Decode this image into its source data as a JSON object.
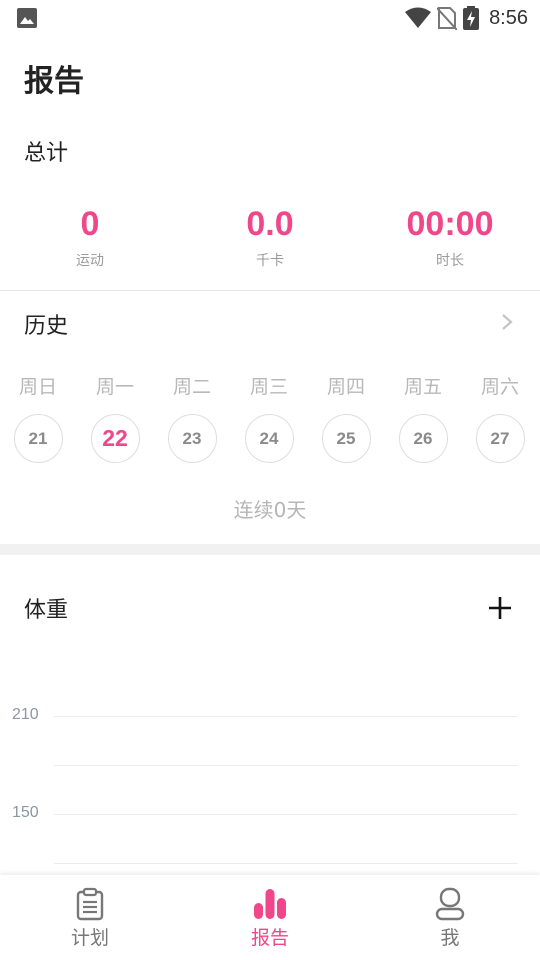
{
  "status_bar": {
    "time": "8:56",
    "icons": [
      "gallery-icon",
      "wifi-icon",
      "no-sim-icon",
      "battery-charging-icon"
    ]
  },
  "page": {
    "title": "报告"
  },
  "totals": {
    "label": "总计",
    "stats": [
      {
        "value": "0",
        "label": "运动"
      },
      {
        "value": "0.0",
        "label": "千卡"
      },
      {
        "value": "00:00",
        "label": "时长"
      }
    ]
  },
  "history": {
    "title": "历史",
    "days": [
      {
        "name": "周日",
        "date": "21"
      },
      {
        "name": "周一",
        "date": "22"
      },
      {
        "name": "周二",
        "date": "23"
      },
      {
        "name": "周三",
        "date": "24"
      },
      {
        "name": "周四",
        "date": "25"
      },
      {
        "name": "周五",
        "date": "26"
      },
      {
        "name": "周六",
        "date": "27"
      }
    ],
    "today_date": "22",
    "streak": "连续0天"
  },
  "weight": {
    "title": "体重",
    "y_ticks": [
      "210",
      "150"
    ]
  },
  "nav": {
    "items": [
      {
        "label": "计划",
        "icon": "clipboard-icon"
      },
      {
        "label": "报告",
        "icon": "bar-chart-icon"
      },
      {
        "label": "我",
        "icon": "profile-icon"
      }
    ],
    "active": "报告"
  },
  "colors": {
    "accent": "#f0468a",
    "muted_text": "#9a9a9a",
    "divider": "#e6e6e6"
  }
}
